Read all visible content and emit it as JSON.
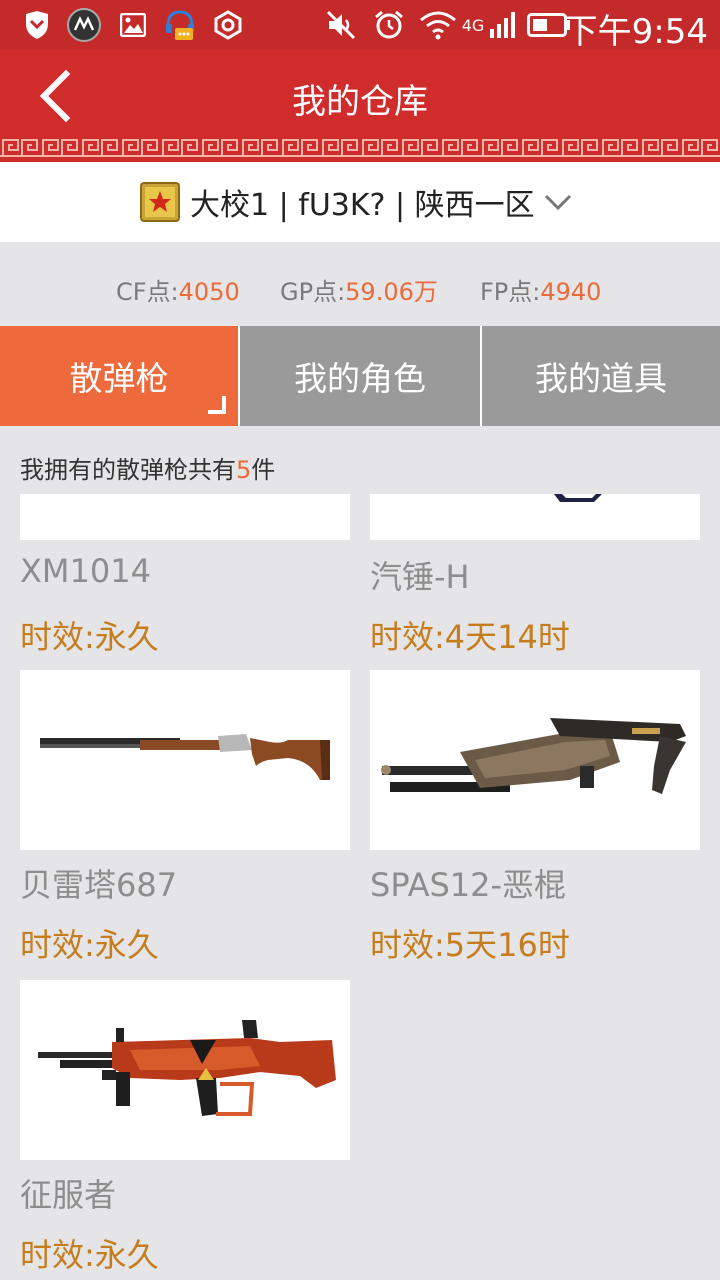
{
  "status_bar": {
    "time": "下午9:54",
    "network": "4G"
  },
  "header": {
    "title": "我的仓库"
  },
  "account": {
    "label": "大校1 | fU3K? | 陕西一区"
  },
  "points": {
    "cf_label": "CF点:",
    "cf_value": "4050",
    "gp_label": "GP点:",
    "gp_value": "59.06万",
    "fp_label": "FP点:",
    "fp_value": "4940"
  },
  "tabs": [
    {
      "label": "散弹枪"
    },
    {
      "label": "我的角色"
    },
    {
      "label": "我的道具"
    }
  ],
  "summary": {
    "prefix": "我拥有的散弹枪共有",
    "count": "5",
    "suffix": "件"
  },
  "items": [
    {
      "name": "XM1014",
      "expire": "时效:永久"
    },
    {
      "name": "汽锤-H",
      "expire": "时效:4天14时"
    },
    {
      "name": "贝雷塔687",
      "expire": "时效:永久"
    },
    {
      "name": "SPAS12-恶棍",
      "expire": "时效:5天16时"
    },
    {
      "name": "征服者",
      "expire": "时效:永久"
    }
  ],
  "colors": {
    "header_red": "#d02c2c",
    "active_tab": "#ee6a3c",
    "inactive_tab": "#9a9a9a",
    "accent_orange": "#ea6a3a",
    "expire_text": "#c57d1e"
  }
}
